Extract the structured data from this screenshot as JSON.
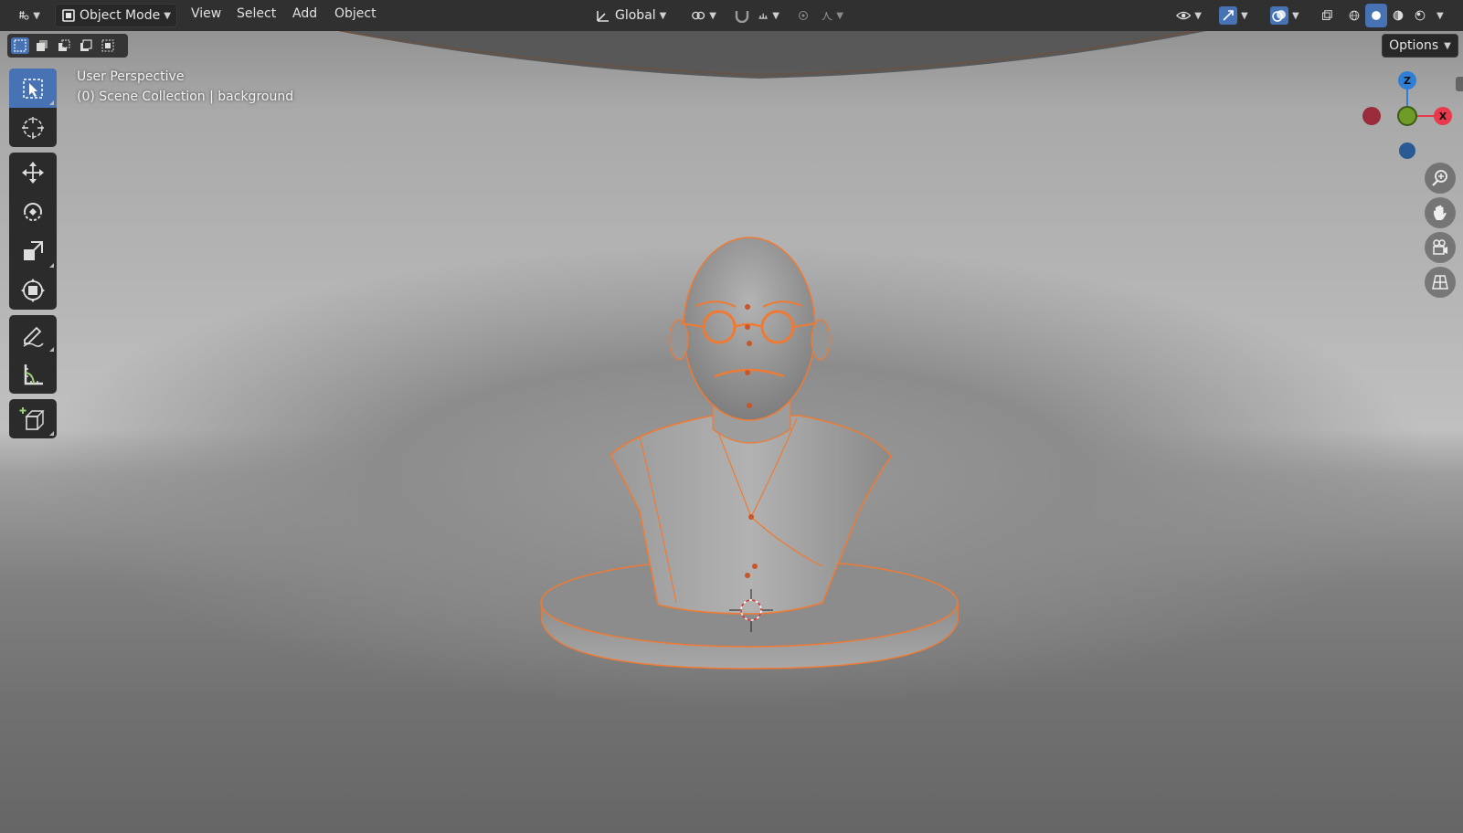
{
  "header": {
    "mode": "Object Mode",
    "menus": [
      "View",
      "Select",
      "Add",
      "Object"
    ],
    "orientation": "Global",
    "options_label": "Options"
  },
  "overlay": {
    "view_name": "User Perspective",
    "collection_info": "(0) Scene Collection | background"
  },
  "gizmo": {
    "z_label": "Z",
    "x_label": "X"
  },
  "tools": [
    "select-box",
    "cursor",
    "move",
    "rotate",
    "scale",
    "transform",
    "annotate",
    "measure",
    "add-cube"
  ],
  "navigation": [
    "zoom",
    "pan",
    "camera",
    "ortho-toggle"
  ],
  "shading": [
    "wireframe",
    "solid",
    "material",
    "rendered"
  ],
  "colors": {
    "header_bg": "#303030",
    "accent_blue": "#4772b3",
    "selection_outline": "#f07a32",
    "axis_x": "#e8394d",
    "axis_y": "#6e9c27",
    "axis_z": "#2f7fd7"
  }
}
